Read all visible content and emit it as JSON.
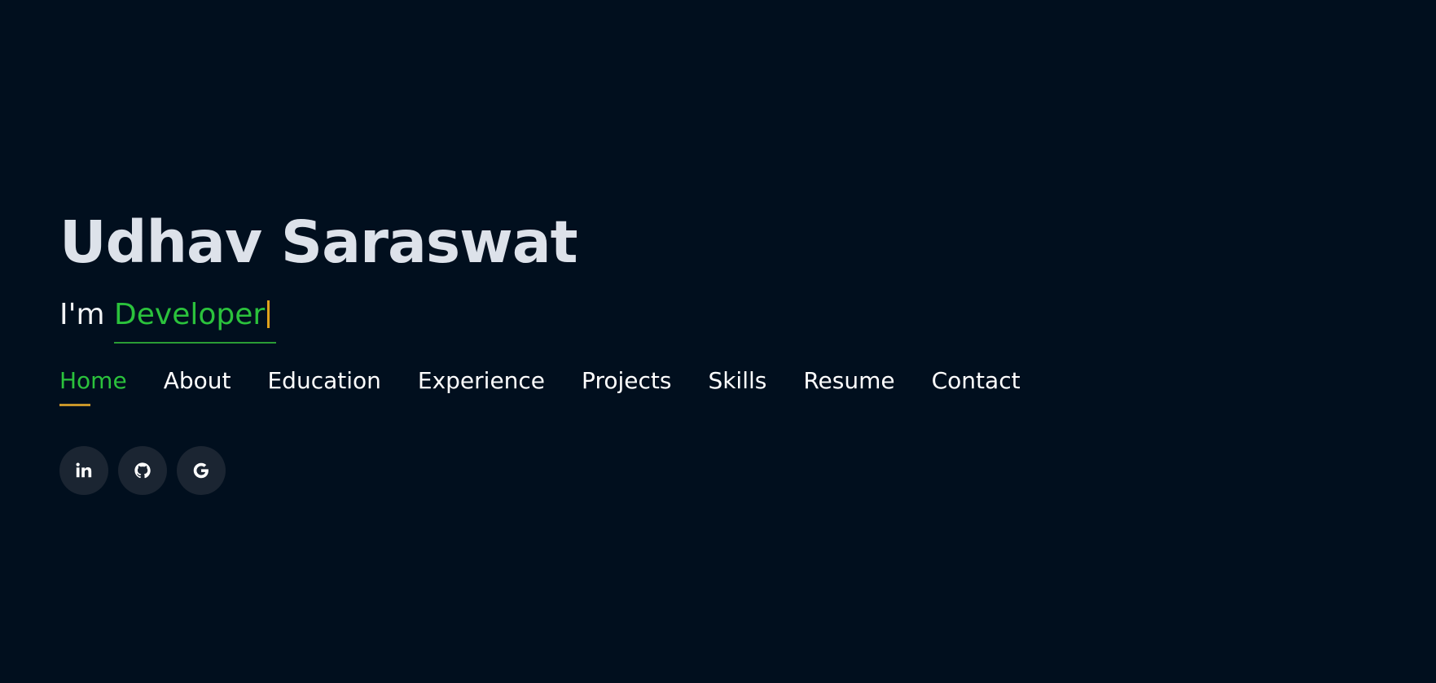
{
  "hero": {
    "name": "Udhav Saraswat",
    "typed_prefix": "I'm",
    "typed_word": "Developer"
  },
  "nav": {
    "items": [
      {
        "label": "Home",
        "active": true
      },
      {
        "label": "About"
      },
      {
        "label": "Education"
      },
      {
        "label": "Experience"
      },
      {
        "label": "Projects"
      },
      {
        "label": "Skills"
      },
      {
        "label": "Resume"
      },
      {
        "label": "Contact"
      }
    ]
  },
  "socials": [
    {
      "icon": "linkedin-icon"
    },
    {
      "icon": "github-icon"
    },
    {
      "icon": "google-icon"
    }
  ],
  "colors": {
    "background": "#010f1e",
    "accent": "#2bc23c",
    "underline_gold": "#c9962a",
    "social_bg": "#1b2532"
  }
}
